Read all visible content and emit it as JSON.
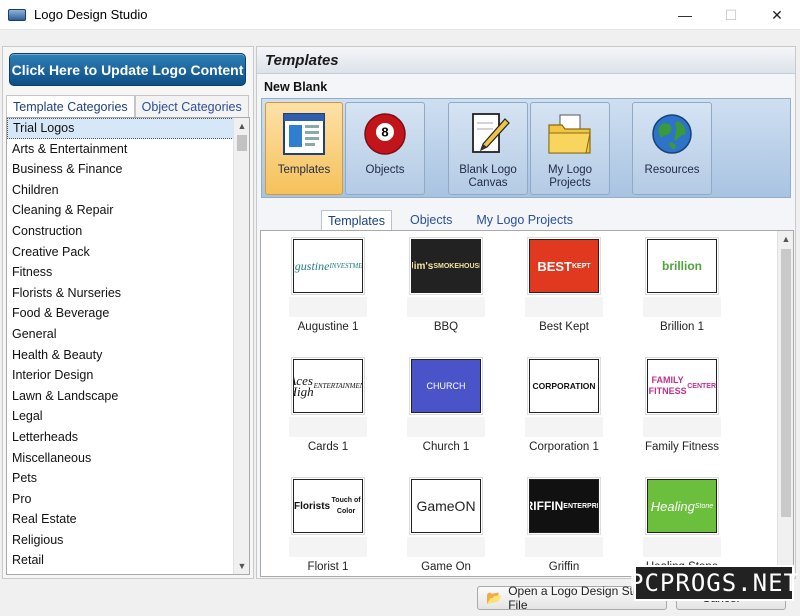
{
  "window": {
    "title": "Logo Design Studio",
    "minimize": "—",
    "maximize": "☐",
    "close": "✕"
  },
  "left": {
    "update_button": "Click Here to Update Logo Content",
    "tabs": [
      "Template Categories",
      "Object Categories"
    ],
    "categories": [
      "Trial Logos",
      "Arts & Entertainment",
      "Business & Finance",
      "Children",
      "Cleaning & Repair",
      "Construction",
      "Creative Pack",
      "Fitness",
      "Florists & Nurseries",
      "Food & Beverage",
      "General",
      "Health & Beauty",
      "Interior Design",
      "Lawn & Landscape",
      "Legal",
      "Letterheads",
      "Miscellaneous",
      "Pets",
      "Pro",
      "Real Estate",
      "Religious",
      "Retail"
    ],
    "selected_index": 0
  },
  "right": {
    "header": "Templates",
    "new_blank": "New Blank",
    "big_buttons": [
      {
        "label": "Templates",
        "icon": "templates-icon"
      },
      {
        "label": "Objects",
        "icon": "billiard-ball-icon",
        "badge": "8"
      },
      {
        "label": "Blank Logo\nCanvas",
        "icon": "pencil-paper-icon"
      },
      {
        "label": "My Logo\nProjects",
        "icon": "folder-icon"
      },
      {
        "label": "Resources",
        "icon": "globe-icon"
      }
    ],
    "view_tabs": [
      "Templates",
      "Objects",
      "My Logo Projects"
    ],
    "thumbnails": [
      {
        "label": "Augustine 1",
        "art": "Augustine",
        "art_sub": "INVESTMENTS"
      },
      {
        "label": "BBQ",
        "art": "Jim's",
        "art_sub": "SMOKEHOUSE"
      },
      {
        "label": "Best Kept",
        "art": "BEST",
        "art_sub": "KEPT"
      },
      {
        "label": "Brillion 1",
        "art": "brillion",
        "art_sub": ""
      },
      {
        "label": "Cards 1",
        "art": "Aces High",
        "art_sub": "ENTERTAINMENT"
      },
      {
        "label": "Church 1",
        "art": "CHURCH",
        "art_sub": ""
      },
      {
        "label": "Corporation 1",
        "art": "CORPORATION",
        "art_sub": ""
      },
      {
        "label": "Family Fitness",
        "art": "FAMILY FITNESS",
        "art_sub": "CENTER"
      },
      {
        "label": "Florist 1",
        "art": "Florists",
        "art_sub": "Touch of Color"
      },
      {
        "label": "Game On",
        "art": "GameON",
        "art_sub": ""
      },
      {
        "label": "Griffin",
        "art": "GRIFFIN",
        "art_sub": "ENTERPRISES"
      },
      {
        "label": "Healing Stone",
        "art": "Healing",
        "art_sub": "Stone"
      }
    ]
  },
  "bottom": {
    "open_button": "Open a Logo Design Studio File",
    "cancel_button": "Cancel"
  },
  "watermark": "PCPROGS.NET",
  "colors": {
    "accent_blue": "#0d4f86",
    "strip_blue": "#b4cbe5",
    "active_orange": "#f6c15a"
  }
}
